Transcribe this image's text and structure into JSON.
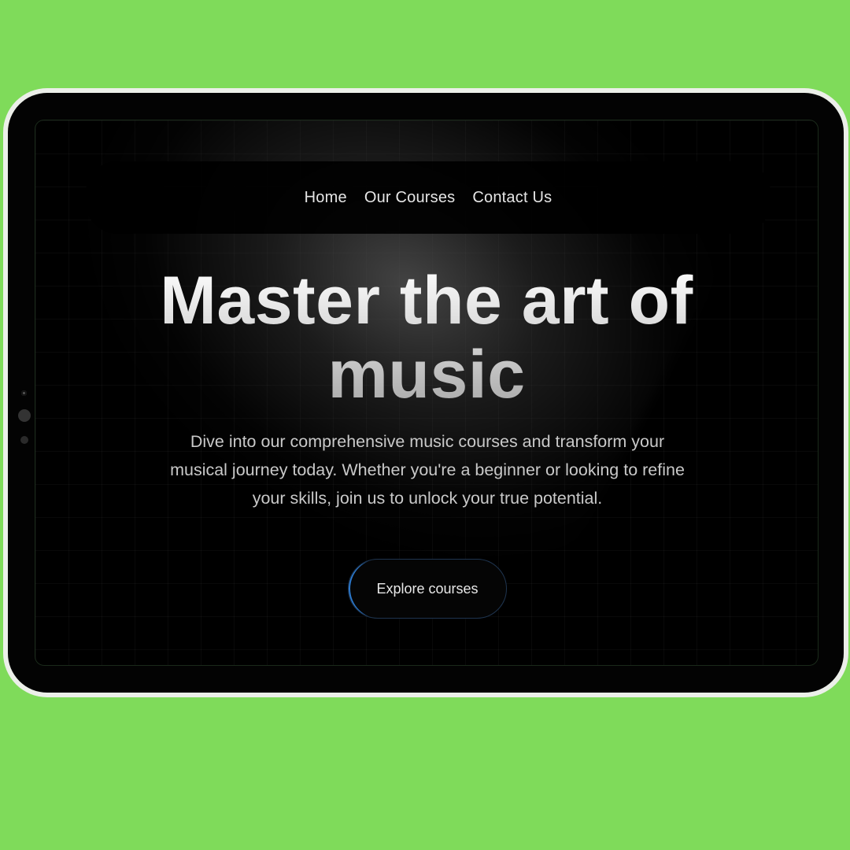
{
  "nav": {
    "items": [
      {
        "label": "Home"
      },
      {
        "label": "Our Courses"
      },
      {
        "label": "Contact Us"
      }
    ]
  },
  "hero": {
    "title_line1": "Master the art of",
    "title_line2": "music",
    "subtitle": "Dive into our comprehensive music courses and transform your musical journey today. Whether you're a beginner or looking to refine your skills, join us to unlock your true potential.",
    "cta_label": "Explore courses"
  },
  "colors": {
    "background": "#7fdb5a",
    "device_frame": "#ecefe9",
    "screen": "#000000",
    "cta_accent": "#2c7bd1"
  }
}
